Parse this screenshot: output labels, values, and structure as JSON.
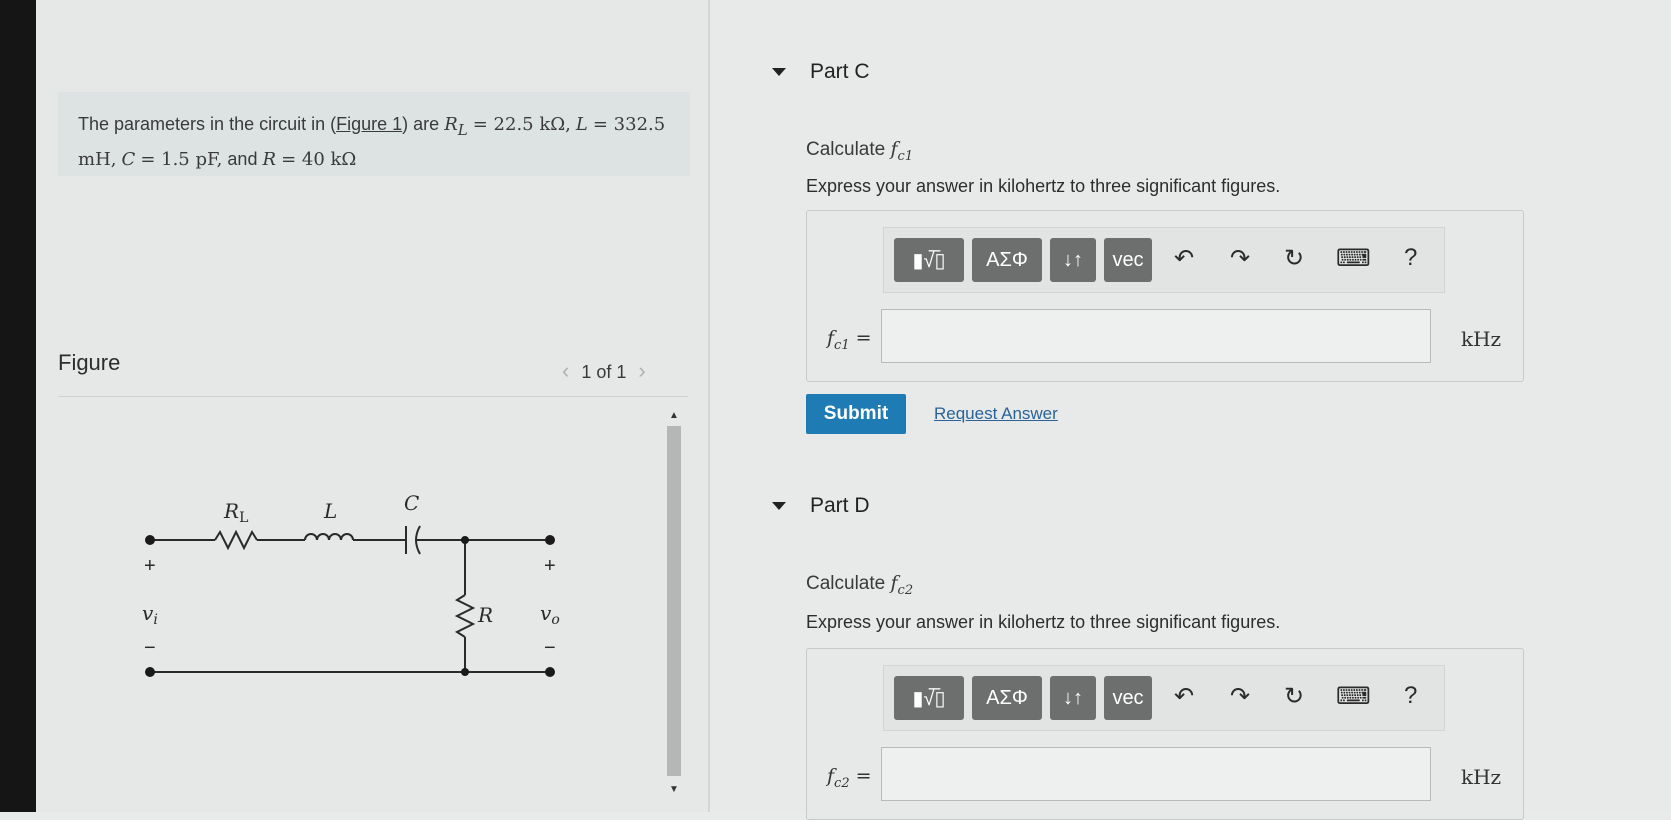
{
  "problem": {
    "intro": "The parameters in the circuit in (",
    "figure_link": "Figure 1",
    "after_link": ") are",
    "rl_sym": "R",
    "rl_sub": "L",
    "rl_val": "= 22.5 kΩ,",
    "l_sym": "L",
    "l_val": "= 332.5 mH,",
    "c_sym": "C",
    "c_val": "= 1.5 pF,",
    "and": "and",
    "r_sym": "R",
    "r_val": "= 40 kΩ"
  },
  "figure": {
    "label": "Figure",
    "pager_prev": "‹",
    "pager_text": "1 of 1",
    "pager_next": "›",
    "circuit_labels": {
      "rl": "R",
      "rl_sub": "L",
      "l": "L",
      "c": "C",
      "r": "R",
      "vi": "v",
      "vi_sub": "i",
      "vo": "v",
      "vo_sub": "o",
      "plus": "+",
      "minus": "−"
    }
  },
  "part_c": {
    "title": "Part C",
    "calc_prefix": "Calculate",
    "var": "f",
    "var_sub": "c1",
    "express": "Express your answer in kilohertz to three significant figures.",
    "label": "f",
    "label_sub": "c1",
    "equals": "=",
    "unit": "kHz",
    "input_value": ""
  },
  "part_d": {
    "title": "Part D",
    "calc_prefix": "Calculate",
    "var": "f",
    "var_sub": "c2",
    "express": "Express your answer in kilohertz to three significant figures.",
    "label": "f",
    "label_sub": "c2",
    "equals": "=",
    "unit": "kHz",
    "input_value": ""
  },
  "toolbar": {
    "template_btn": "▮√̅▯",
    "greek_btn": "ΑΣΦ",
    "sort_btn": "↓↑",
    "vec_btn": "vec",
    "undo": "↶",
    "redo": "↷",
    "reset": "↻",
    "keyboard": "⌨",
    "help": "?"
  },
  "actions": {
    "submit": "Submit",
    "request": "Request Answer"
  }
}
